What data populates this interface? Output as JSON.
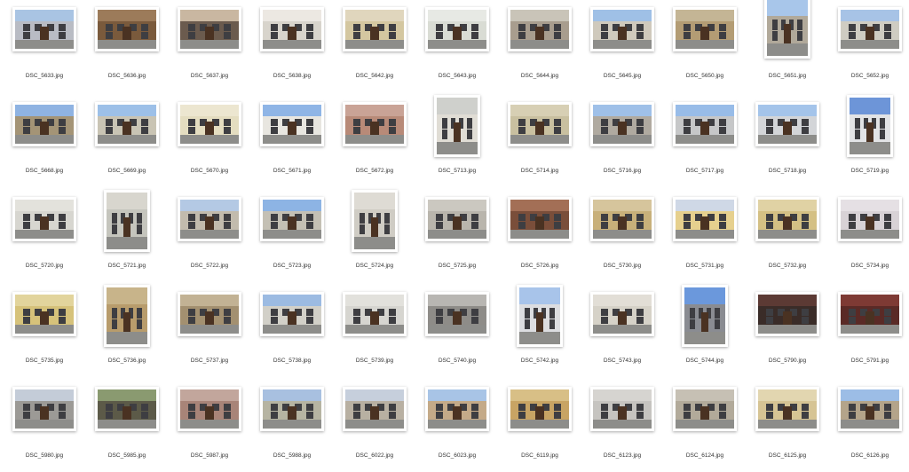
{
  "files": [
    {
      "name": "DSC_5633.jpg",
      "orientation": "landscape",
      "wall": "#b9bcc4",
      "sky": "#a9c4e3"
    },
    {
      "name": "DSC_5636.jpg",
      "orientation": "landscape",
      "wall": "#7a5a3c",
      "sky": "#9c7b5a"
    },
    {
      "name": "DSC_5637.jpg",
      "orientation": "landscape",
      "wall": "#6b5b4e",
      "sky": "#c9b7a1"
    },
    {
      "name": "DSC_5638.jpg",
      "orientation": "landscape",
      "wall": "#d8d4cc",
      "sky": "#ece8e2"
    },
    {
      "name": "DSC_5642.jpg",
      "orientation": "landscape",
      "wall": "#d4c7a0",
      "sky": "#e0d6bd"
    },
    {
      "name": "DSC_5643.jpg",
      "orientation": "landscape",
      "wall": "#d9dcd4",
      "sky": "#e7e9e4"
    },
    {
      "name": "DSC_5644.jpg",
      "orientation": "landscape",
      "wall": "#a89d8e",
      "sky": "#c9c4b8"
    },
    {
      "name": "DSC_5645.jpg",
      "orientation": "landscape",
      "wall": "#cfc9bc",
      "sky": "#9fc0e6"
    },
    {
      "name": "DSC_5650.jpg",
      "orientation": "landscape",
      "wall": "#b39c74",
      "sky": "#c4b595"
    },
    {
      "name": "DSC_5651.jpg",
      "orientation": "portrait",
      "wall": "#b1a99a",
      "sky": "#a8c6ea"
    },
    {
      "name": "DSC_5652.jpg",
      "orientation": "landscape",
      "wall": "#cfccc2",
      "sky": "#a7c3e6"
    },
    {
      "name": "DSC_5668.jpg",
      "orientation": "landscape",
      "wall": "#a49476",
      "sky": "#8fb3e2"
    },
    {
      "name": "DSC_5669.jpg",
      "orientation": "landscape",
      "wall": "#c9c4b4",
      "sky": "#9dc0e8"
    },
    {
      "name": "DSC_5670.jpg",
      "orientation": "landscape",
      "wall": "#e4ddc0",
      "sky": "#ece6d0"
    },
    {
      "name": "DSC_5671.jpg",
      "orientation": "landscape",
      "wall": "#e8e6e0",
      "sky": "#8fb5e6"
    },
    {
      "name": "DSC_5672.jpg",
      "orientation": "landscape",
      "wall": "#b88a78",
      "sky": "#c9a396"
    },
    {
      "name": "DSC_5713.jpg",
      "orientation": "portrait",
      "wall": "#e0ddd5",
      "sky": "#cfd0cc"
    },
    {
      "name": "DSC_5714.jpg",
      "orientation": "landscape",
      "wall": "#c9c0a0",
      "sky": "#d7cfb4"
    },
    {
      "name": "DSC_5716.jpg",
      "orientation": "landscape",
      "wall": "#b0aaa0",
      "sky": "#9fc0e8"
    },
    {
      "name": "DSC_5717.jpg",
      "orientation": "landscape",
      "wall": "#c6c7c8",
      "sky": "#98bce8"
    },
    {
      "name": "DSC_5718.jpg",
      "orientation": "landscape",
      "wall": "#d3d5d8",
      "sky": "#a4c4ea"
    },
    {
      "name": "DSC_5719.jpg",
      "orientation": "portrait",
      "wall": "#e2e3e5",
      "sky": "#6d95d8"
    },
    {
      "name": "DSC_5720.jpg",
      "orientation": "landscape",
      "wall": "#d7d6d0",
      "sky": "#e3e2dc"
    },
    {
      "name": "DSC_5721.jpg",
      "orientation": "portrait",
      "wall": "#c5c5bd",
      "sky": "#d8d6ce"
    },
    {
      "name": "DSC_5722.jpg",
      "orientation": "landscape",
      "wall": "#c2bbad",
      "sky": "#b4c9e4"
    },
    {
      "name": "DSC_5723.jpg",
      "orientation": "landscape",
      "wall": "#c4c0b4",
      "sky": "#8db4e4"
    },
    {
      "name": "DSC_5724.jpg",
      "orientation": "portrait",
      "wall": "#cfccc4",
      "sky": "#dedbd4"
    },
    {
      "name": "DSC_5725.jpg",
      "orientation": "landscape",
      "wall": "#b9b5ac",
      "sky": "#cbc8c0"
    },
    {
      "name": "DSC_5726.jpg",
      "orientation": "landscape",
      "wall": "#7a4e3a",
      "sky": "#a36f56"
    },
    {
      "name": "DSC_5730.jpg",
      "orientation": "landscape",
      "wall": "#c8b07a",
      "sky": "#d6c59c"
    },
    {
      "name": "DSC_5731.jpg",
      "orientation": "landscape",
      "wall": "#e6d08e",
      "sky": "#cfd8e6"
    },
    {
      "name": "DSC_5732.jpg",
      "orientation": "landscape",
      "wall": "#d4c084",
      "sky": "#e0d2a4"
    },
    {
      "name": "DSC_5734.jpg",
      "orientation": "landscape",
      "wall": "#d8d2d6",
      "sky": "#e5e0e4"
    },
    {
      "name": "DSC_5735.jpg",
      "orientation": "landscape",
      "wall": "#d6c27a",
      "sky": "#e2d49c"
    },
    {
      "name": "DSC_5736.jpg",
      "orientation": "portrait",
      "wall": "#b89c6c",
      "sky": "#c8b48a"
    },
    {
      "name": "DSC_5737.jpg",
      "orientation": "landscape",
      "wall": "#a39070",
      "sky": "#c2b294"
    },
    {
      "name": "DSC_5738.jpg",
      "orientation": "landscape",
      "wall": "#d2d0c8",
      "sky": "#9cbbe2"
    },
    {
      "name": "DSC_5739.jpg",
      "orientation": "landscape",
      "wall": "#d6d5d0",
      "sky": "#e2e1dc"
    },
    {
      "name": "DSC_5740.jpg",
      "orientation": "landscape",
      "wall": "#8e8c88",
      "sky": "#b8b6b2"
    },
    {
      "name": "DSC_5742.jpg",
      "orientation": "portrait",
      "wall": "#dcdde0",
      "sky": "#a8c4ea"
    },
    {
      "name": "DSC_5743.jpg",
      "orientation": "landscape",
      "wall": "#d6d2c8",
      "sky": "#e2ded6"
    },
    {
      "name": "DSC_5744.jpg",
      "orientation": "portrait",
      "wall": "#8a8c92",
      "sky": "#6b98dc"
    },
    {
      "name": "DSC_5790.jpg",
      "orientation": "landscape",
      "wall": "#3a2c28",
      "sky": "#5c3a34"
    },
    {
      "name": "DSC_5791.jpg",
      "orientation": "landscape",
      "wall": "#5a2a26",
      "sky": "#7e3a34"
    },
    {
      "name": "DSC_5980.jpg",
      "orientation": "landscape",
      "wall": "#9c9a96",
      "sky": "#c4ccd8"
    },
    {
      "name": "DSC_5985.jpg",
      "orientation": "landscape",
      "wall": "#5c5a48",
      "sky": "#8a9a70"
    },
    {
      "name": "DSC_5987.jpg",
      "orientation": "landscape",
      "wall": "#a88478",
      "sky": "#c2a69c"
    },
    {
      "name": "DSC_5988.jpg",
      "orientation": "landscape",
      "wall": "#b6b4a2",
      "sky": "#a8c0e0"
    },
    {
      "name": "DSC_6022.jpg",
      "orientation": "landscape",
      "wall": "#b8b0a2",
      "sky": "#c6cfdc"
    },
    {
      "name": "DSC_6023.jpg",
      "orientation": "landscape",
      "wall": "#c4aa88",
      "sky": "#a8c4e6"
    },
    {
      "name": "DSC_6119.jpg",
      "orientation": "landscape",
      "wall": "#c8a464",
      "sky": "#d8bf86"
    },
    {
      "name": "DSC_6123.jpg",
      "orientation": "landscape",
      "wall": "#c6c4c0",
      "sky": "#d6d4d0"
    },
    {
      "name": "DSC_6124.jpg",
      "orientation": "landscape",
      "wall": "#b2aa9a",
      "sky": "#c6c0b4"
    },
    {
      "name": "DSC_6125.jpg",
      "orientation": "landscape",
      "wall": "#d6c494",
      "sky": "#e2d6b0"
    },
    {
      "name": "DSC_6126.jpg",
      "orientation": "landscape",
      "wall": "#b4a48a",
      "sky": "#9cbde6"
    }
  ]
}
